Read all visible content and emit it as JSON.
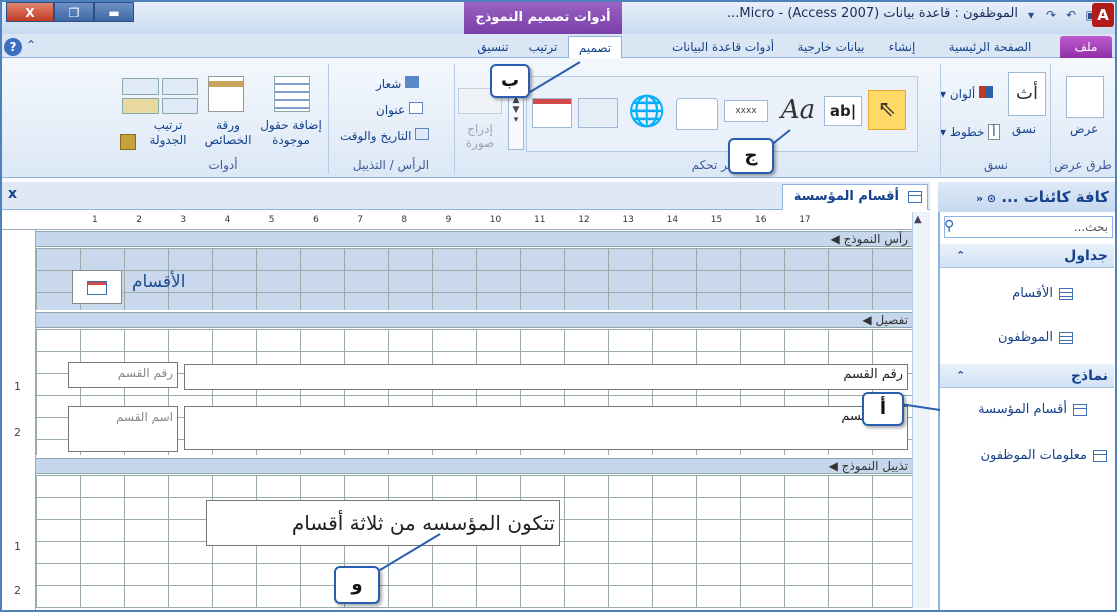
{
  "window": {
    "title": "الموظفون : قاعدة بيانات (Access 2007) - Micro...",
    "context_tab_title": "أدوات تصميم النموذج",
    "app_icon": "A",
    "buttons": {
      "close": "X",
      "restore": "❐",
      "minimize": "▬"
    }
  },
  "tabs": {
    "file": "ملف",
    "home": "الصفحة الرئيسية",
    "create": "إنشاء",
    "external": "بيانات خارجية",
    "dbtools": "أدوات قاعدة البيانات",
    "design": "تصميم",
    "arrange": "ترتيب",
    "format": "تنسيق"
  },
  "ribbon": {
    "view_label": "عرض",
    "views_group": "طرق عرض",
    "themes": "نسق",
    "colors": "ألوان",
    "fonts": "خطوط",
    "themes_group": "نسق",
    "controls_group": "عناصر تحكم",
    "insert_image": "إدراج صورة",
    "logo": "شعار",
    "title": "عنوان",
    "date_time": "التاريخ والوقت",
    "header_footer_group": "الرأس / التذييل",
    "add_fields": "إضافة حقول موجودة",
    "property_sheet": "ورقة الخصائص",
    "tab_order": "ترتيب الجدولة",
    "tools_group": "أدوات",
    "aa": "Aa",
    "ab": "ab|",
    "xxxx": "xxxx"
  },
  "document": {
    "tab_title": "أقسام المؤسسة",
    "close": "x",
    "ruler_numbers": [
      "1",
      "2",
      "3",
      "4",
      "5",
      "6",
      "7",
      "8",
      "9",
      "10",
      "11",
      "12",
      "13",
      "14",
      "15",
      "16",
      "17"
    ],
    "vruler_numbers": [
      "1",
      "2",
      "1",
      "2"
    ],
    "form_header": "رأس النموذج",
    "detail": "تفصيل",
    "form_footer": "تذييل النموذج",
    "header_title": "الأقسام",
    "fields": [
      {
        "label": "رقم القسم",
        "box": "رقم القسم"
      },
      {
        "label": "اسم القسم",
        "box": "اسم القسم"
      }
    ],
    "footer_text": "تتكون المؤسسه من ثلاثة أقسام"
  },
  "nav": {
    "header": "كافة كائنات ...",
    "search_placeholder": "بحث...",
    "groups": [
      {
        "name": "جداول",
        "items": [
          "الأقسام",
          "الموظفون"
        ]
      },
      {
        "name": "نماذج",
        "items": [
          "أقسام المؤسسة",
          "معلومات الموظفون"
        ]
      }
    ]
  },
  "callouts": {
    "a": "أ",
    "b": "ب",
    "c": "ج",
    "d": "و"
  }
}
